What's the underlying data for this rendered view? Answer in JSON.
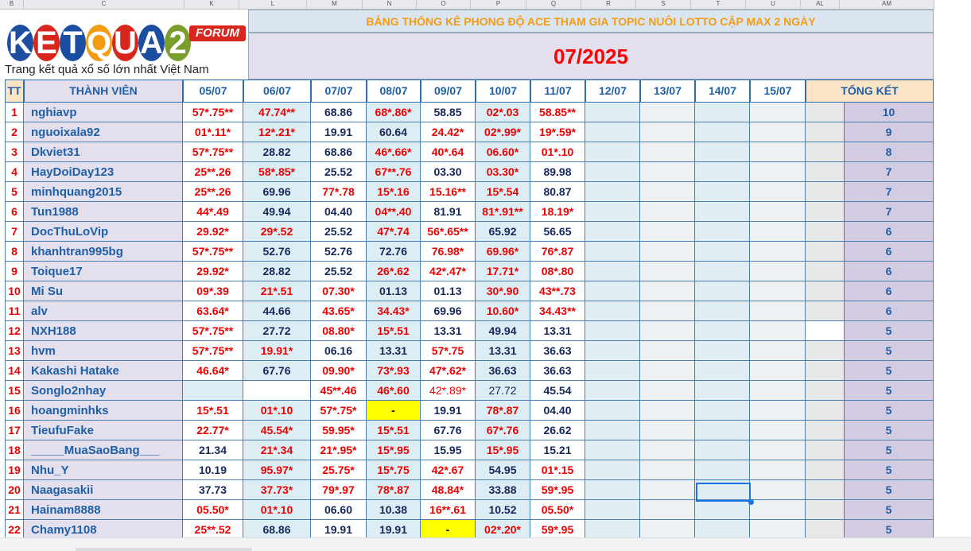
{
  "column_headers": [
    "B",
    "C",
    "K",
    "L",
    "M",
    "N",
    "O",
    "P",
    "Q",
    "R",
    "S",
    "T",
    "U",
    "AL",
    "AM"
  ],
  "logo": {
    "letters": [
      "K",
      "E",
      "T",
      "Q",
      "U",
      "A",
      "2"
    ],
    "letter_colors": [
      "#1b4ea0",
      "#d9261c",
      "#1b4ea0",
      "#f39c12",
      "#d9261c",
      "#1b4ea0",
      "#7a9e2a"
    ],
    "forum_label": "FORUM",
    "slogan": "Trang kết quả xổ số lớn nhất Việt Nam"
  },
  "title": "BẢNG THỐNG KÊ PHONG ĐỘ ACE THAM GIA TOPIC NUÔI LOTTO CẶP MAX 2 NGÀY",
  "month": "07/2025",
  "headers": {
    "tt": "TT",
    "member": "THÀNH VIÊN",
    "dates": [
      "05/07",
      "06/07",
      "07/07",
      "08/07",
      "09/07",
      "10/07",
      "11/07",
      "12/07",
      "13/07",
      "14/07",
      "15/07"
    ],
    "total": "TỔNG KẾT"
  },
  "colors": {
    "win": "#e00000",
    "plain": "#16285a",
    "highlight": "#ffff00",
    "member": "#1f5fa8"
  },
  "rows": [
    {
      "tt": "1",
      "name": "nghiavp",
      "vals": [
        "57*.75**",
        "47.74**",
        "68.86",
        "68*.86*",
        "58.85",
        "02*.03",
        "58.85**"
      ],
      "total": "10"
    },
    {
      "tt": "2",
      "name": "nguoixala92",
      "vals": [
        "01*.11*",
        "12*.21*",
        "19.91",
        "60.64",
        "24.42*",
        "02*.99*",
        "19*.59*"
      ],
      "total": "9"
    },
    {
      "tt": "3",
      "name": "Dkviet31",
      "vals": [
        "57*.75**",
        "28.82",
        "68.86",
        "46*.66*",
        "40*.64",
        "06.60*",
        "01*.10"
      ],
      "total": "8"
    },
    {
      "tt": "4",
      "name": "HayDoiDay123",
      "vals": [
        "25**.26",
        "58*.85*",
        "25.52",
        "67**.76",
        "03.30",
        "03.30*",
        "89.98"
      ],
      "total": "7"
    },
    {
      "tt": "5",
      "name": "minhquang2015",
      "vals": [
        "25**.26",
        "69.96",
        "77*.78",
        "15*.16",
        "15.16**",
        "15*.54",
        "80.87"
      ],
      "total": "7"
    },
    {
      "tt": "6",
      "name": "Tun1988",
      "vals": [
        "44*.49",
        "49.94",
        "04.40",
        "04**.40",
        "81.91",
        "81*.91**",
        "18.19*"
      ],
      "total": "7"
    },
    {
      "tt": "7",
      "name": "DocThuLoVip",
      "vals": [
        "29.92*",
        "29*.52",
        "25.52",
        "47*.74",
        "56*.65**",
        "65.92",
        "56.65"
      ],
      "total": "6"
    },
    {
      "tt": "8",
      "name": "khanhtran995bg",
      "vals": [
        "57*.75**",
        "52.76",
        "52.76",
        "72.76",
        "76.98*",
        "69.96*",
        "76*.87"
      ],
      "total": "6"
    },
    {
      "tt": "9",
      "name": "Toique17",
      "vals": [
        "29.92*",
        "28.82",
        "25.52",
        "26*.62",
        "42*.47*",
        "17.71*",
        "08*.80"
      ],
      "total": "6"
    },
    {
      "tt": "10",
      "name": "Mi Su",
      "vals": [
        "09*.39",
        "21*.51",
        "07.30*",
        "01.13",
        "01.13",
        "30*.90",
        "43**.73"
      ],
      "total": "6"
    },
    {
      "tt": "11",
      "name": "alv",
      "vals": [
        "63.64*",
        "44.66",
        "43.65*",
        "34.43*",
        "69.96",
        "10.60*",
        "34.43**"
      ],
      "total": "6"
    },
    {
      "tt": "12",
      "name": "NXH188",
      "vals": [
        "57*.75**",
        "27.72",
        "08.80*",
        "15*.51",
        "13.31",
        "49.94",
        "13.31"
      ],
      "total": "5"
    },
    {
      "tt": "13",
      "name": "hvm",
      "vals": [
        "57*.75**",
        "19.91*",
        "06.16",
        "13.31",
        "57*.75",
        "13.31",
        "36.63"
      ],
      "total": "5"
    },
    {
      "tt": "14",
      "name": "Kakashi Hatake",
      "vals": [
        "46.64*",
        "67.76",
        "09.90*",
        "73*.93",
        "47*.62*",
        "36.63",
        "36.63"
      ],
      "total": "5"
    },
    {
      "tt": "15",
      "name": "Songlo2nhay",
      "vals": [
        "",
        "",
        "45**.46",
        "46*.60",
        "42*.89*",
        "27.72",
        "45.54"
      ],
      "total": "5"
    },
    {
      "tt": "16",
      "name": "hoangminhks",
      "vals": [
        "15*.51",
        "01*.10",
        "57*.75*",
        "-",
        "19.91",
        "78*.87",
        "04.40"
      ],
      "total": "5"
    },
    {
      "tt": "17",
      "name": "TieufuFake",
      "vals": [
        "22.77*",
        "45.54*",
        "59.95*",
        "15*.51",
        "67.76",
        "67*.76",
        "26.62"
      ],
      "total": "5"
    },
    {
      "tt": "18",
      "name": "_____MuaSaoBang___",
      "vals": [
        "21.34",
        "21*.34",
        "21*.95*",
        "15*.95",
        "15.95",
        "15*.95",
        "15.21"
      ],
      "total": "5"
    },
    {
      "tt": "19",
      "name": "Nhu_Y",
      "vals": [
        "10.19",
        "95.97*",
        "25.75*",
        "15*.75",
        "42*.67",
        "54.95",
        "01*.15"
      ],
      "total": "5"
    },
    {
      "tt": "20",
      "name": "Naagasakii",
      "vals": [
        "37.73",
        "37.73*",
        "79*.97",
        "78*.87",
        "48.84*",
        "33.88",
        "59*.95"
      ],
      "total": "5"
    },
    {
      "tt": "21",
      "name": "Hainam8888",
      "vals": [
        "05.50*",
        "01*.10",
        "06.60",
        "10.38",
        "16**.61",
        "10.52",
        "05.50*"
      ],
      "total": "5"
    },
    {
      "tt": "22",
      "name": "Chamy1108",
      "vals": [
        "25**.52",
        "68.86",
        "19.91",
        "19.91",
        "-",
        "02*.20*",
        "59*.95"
      ],
      "total": "5"
    }
  ]
}
